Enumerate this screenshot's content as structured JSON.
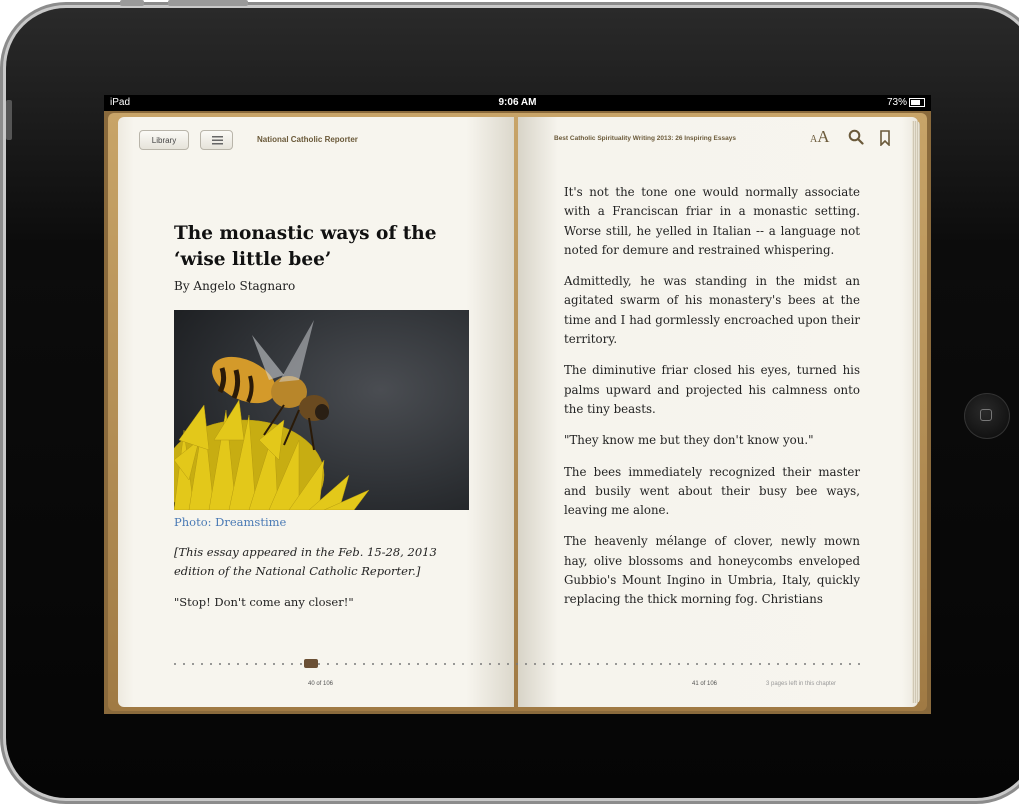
{
  "status_bar": {
    "carrier": "iPad",
    "time": "9:06 AM",
    "battery": "73%"
  },
  "toolbar": {
    "library_label": "Library",
    "left_header": "National Catholic Reporter",
    "right_header": "Best Catholic Spirituality Writing 2013: 26 Inspiring Essays",
    "font_small": "A",
    "font_big": "A"
  },
  "left_page": {
    "title": "The monastic ways of the ‘wise little bee’",
    "byline": "By Angelo Stagnaro",
    "photo_caption": "Photo: Dreamstime",
    "note": "[This essay appeared in the Feb. 15-28, 2013 edition of the National Catholic Reporter.]",
    "quote": "\"Stop! Don't come any closer!\"",
    "page_number": "40 of 106"
  },
  "right_page": {
    "paragraphs": [
      "It's not the tone one would normally associate with a Franciscan friar in a monastic setting. Worse still, he yelled in Italian -- a language not noted for demure and restrained whispering.",
      "Admittedly, he was standing in the midst an agitated swarm of his monastery's bees at the time and I had gormlessly encroached upon their territory.",
      "The diminutive friar closed his eyes, turned his palms upward and projected his calmness onto the tiny beasts.",
      "\"They know me but they don't know you.\"",
      "The bees immediately recognized their master and busily went about their busy bee ways, leaving me alone.",
      "The heavenly mélange of clover, newly mown hay, olive blossoms and honeycombs enveloped Gubbio's Mount Ingino in Umbria, Italy, quickly replacing the thick morning fog. Christians"
    ],
    "page_number": "41 of 106",
    "pages_left": "3 pages left in this chapter"
  },
  "progress": {
    "position": 0.38
  },
  "icons": {
    "search": "search-icon",
    "bookmark": "bookmark-icon",
    "toc": "list-icon",
    "home": "home-button-icon"
  }
}
